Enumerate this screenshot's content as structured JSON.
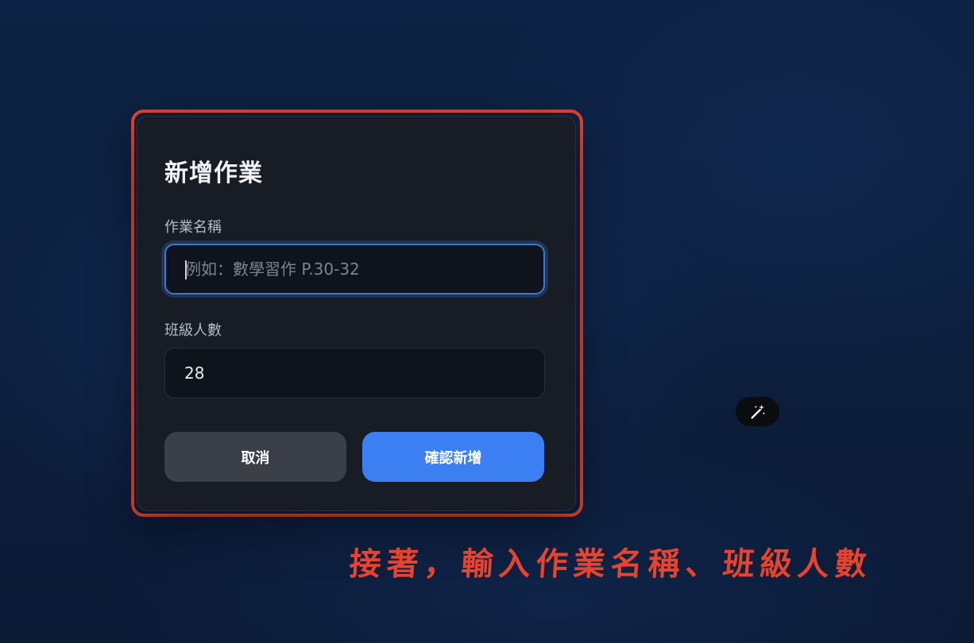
{
  "modal": {
    "title": "新增作業",
    "fields": {
      "name": {
        "label": "作業名稱",
        "value": "",
        "placeholder": "例如：數學習作 P.30-32"
      },
      "count": {
        "label": "班級人數",
        "value": "28"
      }
    },
    "buttons": {
      "cancel_label": "取消",
      "confirm_label": "確認新增"
    }
  },
  "floating_button": {
    "icon": "magic-wand-icon"
  },
  "annotation": {
    "text": "接著，輸入作業名稱、班級人數",
    "color": "#e8432c"
  },
  "colors": {
    "accent": "#3b7ff2",
    "highlight": "#e8432c",
    "modal_bg": "#181c24"
  }
}
